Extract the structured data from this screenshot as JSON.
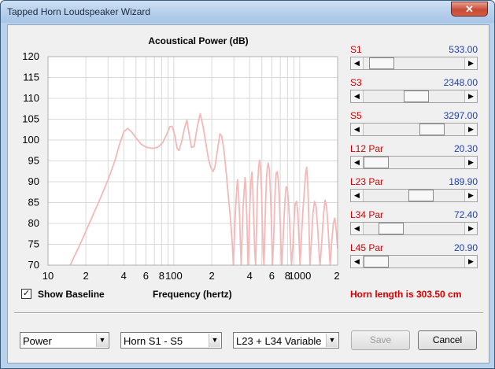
{
  "window": {
    "title": "Tapped Horn Loudspeaker Wizard",
    "close_glyph": "✕"
  },
  "chart_data": {
    "type": "line",
    "title": "Acoustical Power (dB)",
    "xlabel": "Frequency (hertz)",
    "ylabel": "",
    "x_scale": "log",
    "xlim": [
      10,
      2000
    ],
    "ylim": [
      70,
      120
    ],
    "grid": true,
    "x_tick_labels": [
      "10",
      "2",
      "4",
      "6",
      "8",
      "100",
      "2",
      "4",
      "6",
      "8",
      "1000",
      "2"
    ],
    "y_tick_labels": [
      "120",
      "115",
      "110",
      "105",
      "100",
      "95",
      "90",
      "85",
      "80",
      "75",
      "70"
    ],
    "series": [
      {
        "color": "#f4b8b8",
        "points": [
          [
            15,
            70
          ],
          [
            18,
            75
          ],
          [
            22,
            81
          ],
          [
            26,
            86
          ],
          [
            30,
            90.5
          ],
          [
            34,
            95
          ],
          [
            37,
            99
          ],
          [
            40,
            102
          ],
          [
            43,
            102.8
          ],
          [
            46,
            102
          ],
          [
            50,
            100.5
          ],
          [
            55,
            99
          ],
          [
            60,
            98.3
          ],
          [
            68,
            98
          ],
          [
            75,
            98.3
          ],
          [
            82,
            99.5
          ],
          [
            88,
            101.5
          ],
          [
            93,
            103.2
          ],
          [
            97,
            103.3
          ],
          [
            102,
            101
          ],
          [
            106,
            98
          ],
          [
            110,
            97.5
          ],
          [
            115,
            99.5
          ],
          [
            122,
            103
          ],
          [
            127,
            104.8
          ],
          [
            132,
            101.5
          ],
          [
            138,
            98.2
          ],
          [
            145,
            98.5
          ],
          [
            153,
            103
          ],
          [
            162,
            106.3
          ],
          [
            170,
            103.5
          ],
          [
            180,
            99
          ],
          [
            188,
            95.5
          ],
          [
            196,
            93.5
          ],
          [
            205,
            92.5
          ],
          [
            212,
            93.5
          ],
          [
            222,
            97.5
          ],
          [
            232,
            101.5
          ],
          [
            240,
            101
          ],
          [
            250,
            97.5
          ],
          [
            262,
            91.5
          ],
          [
            272,
            86
          ],
          [
            282,
            81
          ],
          [
            290,
            76
          ],
          [
            297,
            70
          ],
          [
            303,
            77
          ],
          [
            308,
            82.5
          ],
          [
            315,
            87.5
          ],
          [
            320,
            90.5
          ],
          [
            327,
            87
          ],
          [
            333,
            81.5
          ],
          [
            338,
            75
          ],
          [
            343,
            70
          ],
          [
            350,
            78.5
          ],
          [
            355,
            84
          ],
          [
            362,
            88
          ],
          [
            368,
            91
          ],
          [
            375,
            87
          ],
          [
            382,
            79
          ],
          [
            388,
            70
          ],
          [
            395,
            76
          ],
          [
            402,
            85
          ],
          [
            410,
            90
          ],
          [
            417,
            92.3
          ],
          [
            424,
            88
          ],
          [
            432,
            80
          ],
          [
            440,
            73
          ],
          [
            446,
            70
          ],
          [
            455,
            80
          ],
          [
            462,
            89
          ],
          [
            472,
            93.5
          ],
          [
            480,
            95.2
          ],
          [
            488,
            93.5
          ],
          [
            497,
            88
          ],
          [
            505,
            80
          ],
          [
            512,
            73
          ],
          [
            520,
            70
          ],
          [
            528,
            78
          ],
          [
            537,
            86
          ],
          [
            545,
            91
          ],
          [
            553,
            93.5
          ],
          [
            562,
            94.5
          ],
          [
            572,
            93
          ],
          [
            582,
            89
          ],
          [
            592,
            83
          ],
          [
            600,
            76
          ],
          [
            608,
            70
          ],
          [
            620,
            76
          ],
          [
            630,
            83
          ],
          [
            640,
            89
          ],
          [
            650,
            92
          ],
          [
            662,
            92.4
          ],
          [
            675,
            90.5
          ],
          [
            688,
            86
          ],
          [
            700,
            80
          ],
          [
            712,
            73
          ],
          [
            720,
            70
          ],
          [
            735,
            75
          ],
          [
            750,
            81
          ],
          [
            765,
            86
          ],
          [
            780,
            88.8
          ],
          [
            797,
            88.5
          ],
          [
            815,
            85
          ],
          [
            832,
            80
          ],
          [
            850,
            73
          ],
          [
            860,
            70
          ],
          [
            880,
            74
          ],
          [
            900,
            80
          ],
          [
            920,
            84.8
          ],
          [
            945,
            85.3
          ],
          [
            968,
            82
          ],
          [
            990,
            75
          ],
          [
            1005,
            70
          ],
          [
            1030,
            76
          ],
          [
            1060,
            83
          ],
          [
            1090,
            88
          ],
          [
            1115,
            92
          ],
          [
            1135,
            93.5
          ],
          [
            1160,
            89
          ],
          [
            1185,
            80
          ],
          [
            1205,
            70
          ],
          [
            1240,
            76
          ],
          [
            1275,
            82.5
          ],
          [
            1310,
            85.3
          ],
          [
            1350,
            84
          ],
          [
            1395,
            78
          ],
          [
            1430,
            72
          ],
          [
            1450,
            70
          ],
          [
            1500,
            76
          ],
          [
            1545,
            82
          ],
          [
            1590,
            85.6
          ],
          [
            1635,
            84
          ],
          [
            1680,
            79
          ],
          [
            1720,
            73
          ],
          [
            1745,
            70
          ],
          [
            1800,
            76
          ],
          [
            1850,
            80
          ],
          [
            1900,
            81.3
          ],
          [
            1950,
            78.5
          ],
          [
            2000,
            74
          ]
        ]
      }
    ]
  },
  "baseline": {
    "label": "Show Baseline",
    "checked": true,
    "check_glyph": "✓"
  },
  "params": [
    {
      "name": "S1",
      "value": "533.00",
      "level": 0.07
    },
    {
      "name": "S3",
      "value": "2348.00",
      "level": 0.53
    },
    {
      "name": "S5",
      "value": "3297.00",
      "level": 0.74
    },
    {
      "name": "L12 Par",
      "value": "20.30",
      "level": 0.0
    },
    {
      "name": "L23 Par",
      "value": "189.90",
      "level": 0.59
    },
    {
      "name": "L34 Par",
      "value": "72.40",
      "level": 0.2
    },
    {
      "name": "L45 Par",
      "value": "20.90",
      "level": 0.0
    }
  ],
  "arrows": {
    "left": "◀",
    "right": "▶",
    "down": "▼"
  },
  "horn_length": "Horn length is 303.50 cm",
  "controls": {
    "plot_select": "Power",
    "horn_select": "Horn S1 - S5",
    "variable_select": "L23 + L34 Variable",
    "save_label": "Save",
    "cancel_label": "Cancel"
  }
}
